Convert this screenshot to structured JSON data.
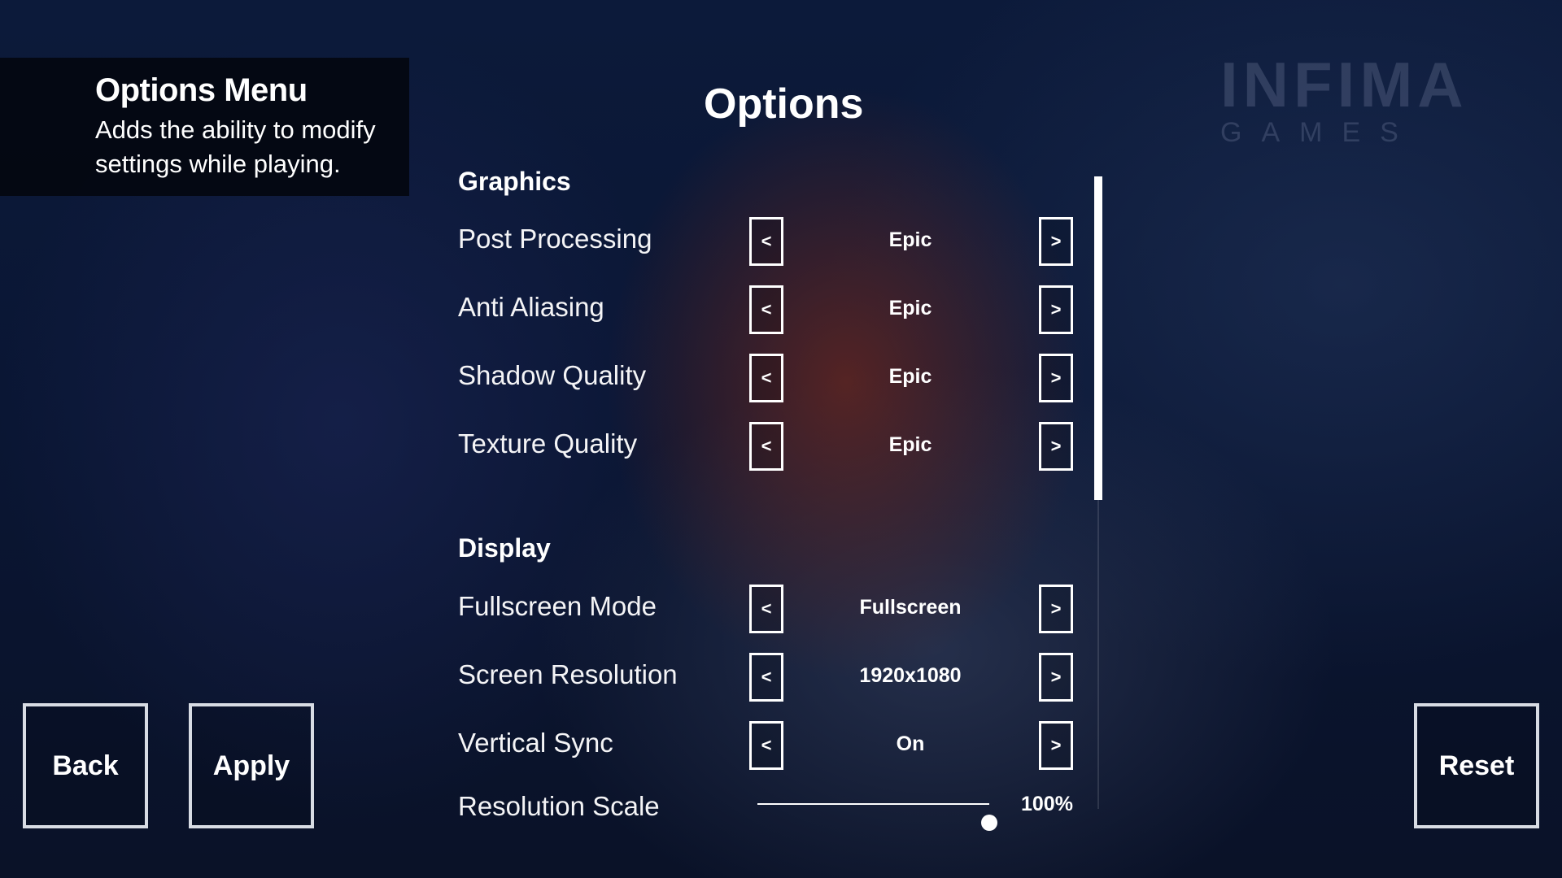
{
  "info": {
    "title": "Options Menu",
    "description": "Adds the ability to modify settings while playing."
  },
  "page_title": "Options",
  "logo": {
    "main": "INFIMA",
    "sub": "GAMES"
  },
  "sections": {
    "graphics": {
      "title": "Graphics",
      "rows": [
        {
          "label": "Post Processing",
          "value": "Epic"
        },
        {
          "label": "Anti Aliasing",
          "value": "Epic"
        },
        {
          "label": "Shadow Quality",
          "value": "Epic"
        },
        {
          "label": "Texture Quality",
          "value": "Epic"
        }
      ]
    },
    "display": {
      "title": "Display",
      "rows": [
        {
          "label": "Fullscreen Mode",
          "value": "Fullscreen"
        },
        {
          "label": "Screen Resolution",
          "value": "1920x1080"
        },
        {
          "label": "Vertical Sync",
          "value": "On"
        }
      ],
      "resolution_scale": {
        "label": "Resolution Scale",
        "value_text": "100%",
        "value": 1.0
      }
    }
  },
  "arrows": {
    "left": "<",
    "right": ">"
  },
  "buttons": {
    "back": "Back",
    "apply": "Apply",
    "reset": "Reset"
  },
  "icons": {
    "left_arrow": "chevron-left-icon",
    "right_arrow": "chevron-right-icon"
  }
}
